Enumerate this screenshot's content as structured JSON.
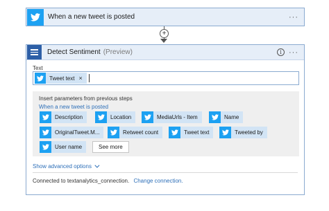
{
  "trigger": {
    "title": "When a new tweet is posted",
    "more_label": "···"
  },
  "connector": {
    "plus_label": "+"
  },
  "action": {
    "title": "Detect Sentiment",
    "preview": "(Preview)",
    "info_label": "i",
    "more_label": "···",
    "text_field_label": "Text",
    "token": {
      "label": "Tweet text",
      "remove": "×"
    },
    "insert_hint": "Insert parameters from previous steps",
    "source_step": "When a new tweet is posted",
    "parameters": [
      {
        "label": "Description"
      },
      {
        "label": "Location"
      },
      {
        "label": "MediaUrls - Item"
      },
      {
        "label": "Name"
      },
      {
        "label": "OriginalTweet.M..."
      },
      {
        "label": "Retweet count"
      },
      {
        "label": "Tweet text"
      },
      {
        "label": "Tweeted by"
      },
      {
        "label": "User name"
      }
    ],
    "see_more": "See more",
    "advanced_options": "Show advanced options",
    "connected_to": "Connected to textanalytics_connection.",
    "change_connection": "Change connection."
  },
  "colors": {
    "twitter": "#1da1f2",
    "text_analytics": "#2d5fa7",
    "link": "#2d6fb8",
    "card_header": "#e6eef8"
  },
  "icons": {
    "twitter": "twitter-icon",
    "text_analytics": "text-analytics-icon",
    "info": "info-icon"
  }
}
